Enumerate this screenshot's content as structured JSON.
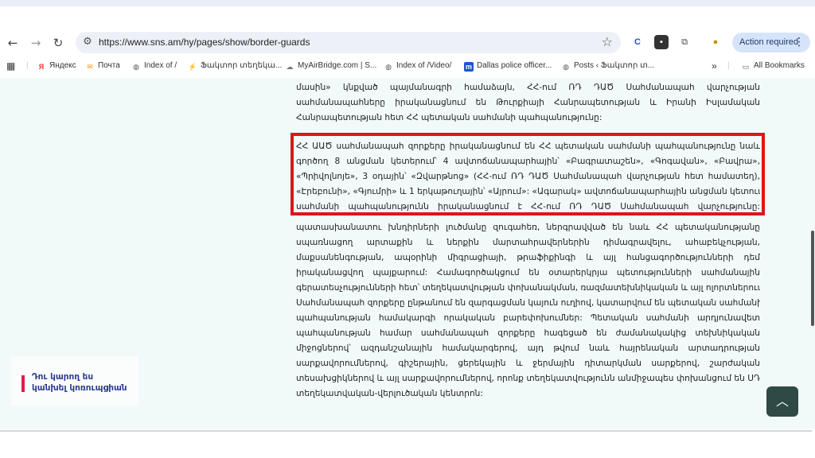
{
  "browser": {
    "url": "https://www.sns.am/hy/pages/show/border-guards",
    "action_label": "Action required"
  },
  "bookmarks": [
    {
      "label": "Яндекс",
      "icon": "yandex-icon",
      "color": "#f33"
    },
    {
      "label": "Почта",
      "icon": "mail-icon",
      "color": "#f90"
    },
    {
      "label": "Index of /",
      "icon": "globe-icon",
      "color": "#555"
    },
    {
      "label": "Ֆակտոր տեղեկա...",
      "icon": "factor-icon",
      "color": "#e33"
    },
    {
      "label": "MyAirBridge.com | S...",
      "icon": "cloud-icon",
      "color": "#777"
    },
    {
      "label": "Index of /Video/",
      "icon": "globe-icon",
      "color": "#555"
    },
    {
      "label": "Dallas police officer...",
      "icon": "news-icon",
      "color": "#2255cc"
    },
    {
      "label": "Posts ‹ Ֆակտոր տ...",
      "icon": "wordpress-icon",
      "color": "#555"
    }
  ],
  "all_bookmarks": "All Bookmarks",
  "content": {
    "p1_lines": [
      "մասին» կնքված պայմանագրի համաձայն, ՀՀ-ում ՌԴ ԴԱԾ Սահմանապահ վարչության",
      "սահմանապահները իրականացնում են Թուրքիայի Հանրապետության և Իրանի Իսլամական",
      "Հանրապետության հետ ՀՀ պետական սահմանի պահպանությունը:"
    ],
    "p2_lines": [
      "ՀՀ ԱԱԾ սահմանապահ զորքերը իրականացնում են ՀՀ պետական սահմանի պահպանությունը նաև",
      "գործող 8 անցման կետերում՝ 4 ավտոճանապարհային՝ «Բագրատաշեն», «Գոգավան», «Բավրա»,",
      "«Պրիվոլնոյե», 3 օդային՝ «Զվարթնոց» (ՀՀ-ում ՌԴ ԴԱԾ Սահմանապահ վարչության հետ համատեղ),",
      "«Էրեբունի», «Գյումրի» և 1 երկաթուղային՝ «Այրում»: «Ագարակ» ավտոճանապարհային անցման կետում",
      "սահմանի պահպանությունն իրականացնում է ՀՀ-ում ՌԴ ԴԱԾ Սահմանապահ վարչությունը:"
    ],
    "p3_lines": [
      "պատասխանատու խնդիրների լուծմանը զուգահեռ, ներգրավված են նաև ՀՀ պետականությանը",
      "սպառնացող արտաքին և ներքին մարտահրավերներին դիմագրավելու, ահաբեկչության,",
      "մաքսանենգության, ապօրինի միգրացիայի, թրաֆիքինգի և այլ հանցագործությունների դեմ",
      "իրականացվող պայքարում: Համագործակցում են օտարերկրյա պետությունների սահմանային",
      "գերատեսչությունների հետ՝ տեղեկատվության փոխանակման, ռազմատեխնիկական և այլ ոլորտներում:",
      "Սահմանապահ զորքերը ընթանում են զարգացման կայուն ուղիով, կատարվում են պետական սահմանի",
      "պահպանության համակարգի որակական բարեփոխումներ: Պետական սահմանի արդյունավետ",
      "պահպանության համար սահմանապահ զորքերը հագեցած են ժամանակակից տեխնիկական",
      "միջոցներով՝ ազդանշանային համակարգերով, այդ թվում նաև հայրենական արտադրության",
      "սարքավորումներով, գիշերային, ցերեկային և ջերմային դիտարկման սարքերով, շարժական",
      "տեսախցիկներով և այլ սարքավորումներով, որոնք տեղեկատվությունն անմիջապես փոխանցում են ՍԴ",
      "տեղեկատվական-վերլուծական կենտրոն:"
    ]
  },
  "side_banner": {
    "line1": "Դու կարող ես",
    "line2": "կանխել կոռուպցիան"
  },
  "colors": {
    "page_bg": "#f1faf9",
    "highlight": "#e0141b",
    "accent": "#2b3a8c",
    "to_top_bg": "#2f4a44"
  }
}
